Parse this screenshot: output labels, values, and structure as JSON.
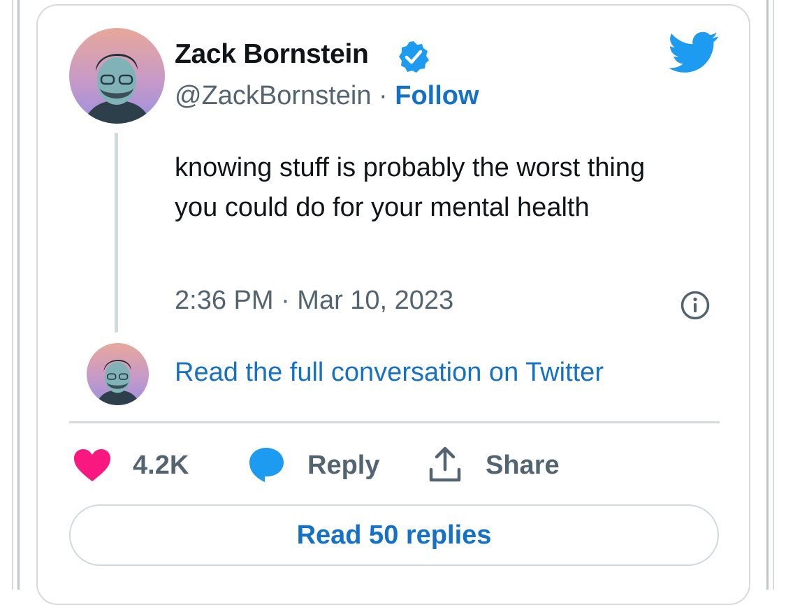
{
  "author": {
    "name": "Zack Bornstein",
    "handle": "@ZackBornstein",
    "separator": "·",
    "follow_label": "Follow",
    "verified": true
  },
  "tweet": {
    "text": "knowing stuff is probably the worst thing you could do for your mental health",
    "timestamp": "2:36 PM · Mar 10, 2023"
  },
  "conversation_link": "Read the full conversation on Twitter",
  "actions": {
    "like_count": "4.2K",
    "reply_label": "Reply",
    "share_label": "Share"
  },
  "read_replies_label": "Read 50 replies",
  "icons": {
    "brand": "twitter-bird-icon",
    "verified": "verified-badge-icon",
    "info": "info-icon",
    "like": "heart-icon",
    "reply": "reply-bubble-icon",
    "share": "share-icon"
  },
  "colors": {
    "link_blue": "#1570c8",
    "twitter_blue": "#1d9bf0",
    "like_pink": "#f91880",
    "muted_text": "#536471"
  }
}
